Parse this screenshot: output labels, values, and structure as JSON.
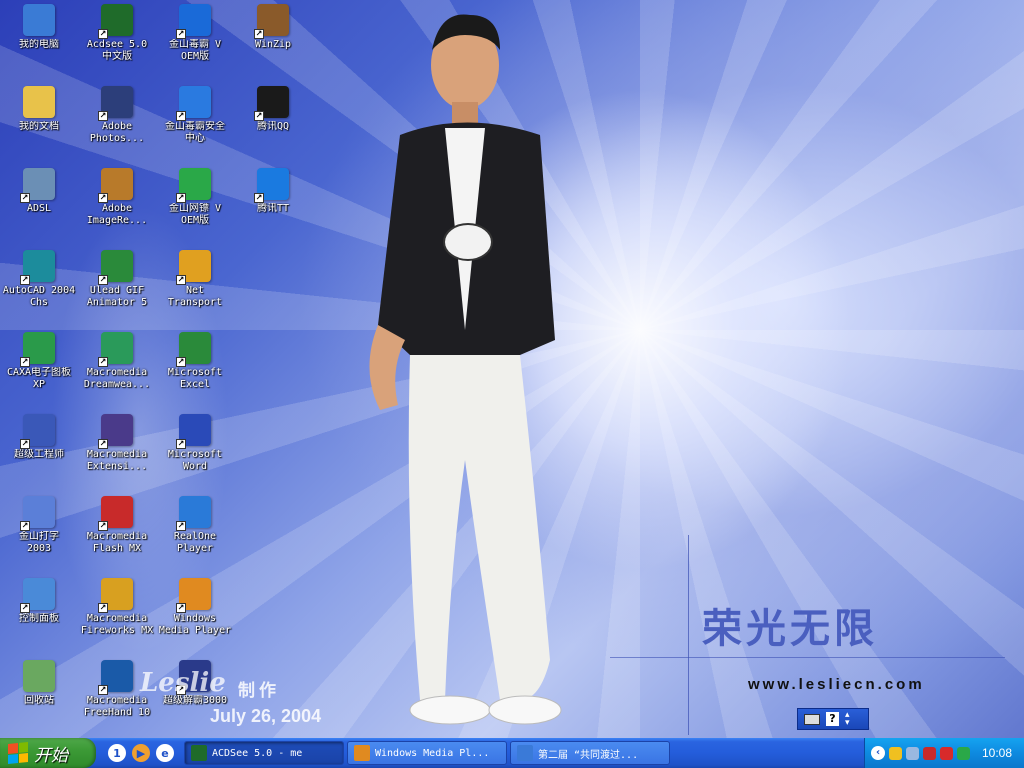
{
  "desktop": {
    "icons": [
      {
        "label": "我的电脑",
        "icon": "my-computer-icon",
        "color": "#3a7bd5"
      },
      {
        "label": "我的文档",
        "icon": "my-documents-icon",
        "color": "#e8c24a"
      },
      {
        "label": "ADSL",
        "icon": "network-icon",
        "color": "#6b8fb5"
      },
      {
        "label": "AutoCAD 2004\nChs",
        "icon": "autocad-icon",
        "color": "#1c8c9c"
      },
      {
        "label": "CAXA电子图板\nXP",
        "icon": "caxa-icon",
        "color": "#2a9a4a"
      },
      {
        "label": "超级工程师",
        "icon": "super-engineer-icon",
        "color": "#3a58b8"
      },
      {
        "label": "金山打字\n2003",
        "icon": "typing-icon",
        "color": "#5b7fd8"
      },
      {
        "label": "控制面板",
        "icon": "control-panel-icon",
        "color": "#4a8ad8"
      },
      {
        "label": "回收站",
        "icon": "recycle-bin-icon",
        "color": "#6aa860"
      },
      {
        "label": "Acdsee 5.0\n中文版",
        "icon": "acdsee-icon",
        "color": "#1f6b2a"
      },
      {
        "label": "Adobe\nPhotos...",
        "icon": "photoshop-icon",
        "color": "#2c3e7a"
      },
      {
        "label": "Adobe\nImageRe...",
        "icon": "imageready-icon",
        "color": "#b87a2a"
      },
      {
        "label": "Ulead GIF\nAnimator 5",
        "icon": "gif-animator-icon",
        "color": "#2a8a3a"
      },
      {
        "label": "Macromedia\nDreamwea...",
        "icon": "dreamweaver-icon",
        "color": "#2a9a5a"
      },
      {
        "label": "Macromedia\nExtensi...",
        "icon": "extension-icon",
        "color": "#4a3a8a"
      },
      {
        "label": "Macromedia\nFlash MX",
        "icon": "flash-icon",
        "color": "#c82a2a"
      },
      {
        "label": "Macromedia\nFireworks MX",
        "icon": "fireworks-icon",
        "color": "#d8a020"
      },
      {
        "label": "Macromedia\nFreeHand 10",
        "icon": "freehand-icon",
        "color": "#1a5aa8"
      },
      {
        "label": "金山毒霸 V\nOEM版",
        "icon": "antivirus-icon",
        "color": "#1a6ad8"
      },
      {
        "label": "金山毒霸安全\n中心",
        "icon": "security-center-icon",
        "color": "#2a7ae0"
      },
      {
        "label": "金山网镖 V\nOEM版",
        "icon": "firewall-icon",
        "color": "#2aa848"
      },
      {
        "label": "Net\nTransport",
        "icon": "net-transport-icon",
        "color": "#e0a020"
      },
      {
        "label": "Microsoft\nExcel",
        "icon": "excel-icon",
        "color": "#2a8a3a"
      },
      {
        "label": "Microsoft\nWord",
        "icon": "word-icon",
        "color": "#2a4ab8"
      },
      {
        "label": "RealOne\nPlayer",
        "icon": "realone-icon",
        "color": "#2a7ad8"
      },
      {
        "label": "Windows\nMedia Player",
        "icon": "media-player-icon",
        "color": "#e08a20"
      },
      {
        "label": "超级解霸3000",
        "icon": "super-jieba-icon",
        "color": "#2a3a8a"
      },
      {
        "label": "WinZip",
        "icon": "winzip-icon",
        "color": "#8a5a2a"
      },
      {
        "label": "腾讯QQ",
        "icon": "qq-icon",
        "color": "#1a1a1a"
      },
      {
        "label": "腾讯TT",
        "icon": "tt-icon",
        "color": "#1a7ae0"
      }
    ]
  },
  "wallpaper": {
    "title": "荣光无限",
    "site": "www.lesliecn.com",
    "signature": "Leslie",
    "made": "制作",
    "date": "July 26, 2004"
  },
  "langbar": {
    "help": "?"
  },
  "taskbar": {
    "start_label": "开始",
    "quick_launch": [
      {
        "icon": "show-desktop-icon",
        "color": "#ffffff",
        "glyph": "1"
      },
      {
        "icon": "media-player-quick-icon",
        "color": "#f0a030",
        "glyph": "▶"
      },
      {
        "icon": "ie-icon",
        "color": "#ffffff",
        "glyph": "e"
      }
    ],
    "tasks": [
      {
        "label": "ACDSee 5.0 - me",
        "icon": "acdsee-task-icon",
        "color": "#1f6b2a",
        "active": true
      },
      {
        "label": "Windows Media Pl...",
        "icon": "media-player-task-icon",
        "color": "#e08a20",
        "active": false
      },
      {
        "label": "第二届 “共同渡过...",
        "icon": "ie-task-icon",
        "color": "#3a7ad8",
        "active": false
      }
    ],
    "tray": [
      {
        "icon": "qq-tray-icon",
        "color": "#f0c020"
      },
      {
        "icon": "network-tray-icon",
        "color": "#9ab8e0"
      },
      {
        "icon": "firewall-tray-icon",
        "color": "#c82a2a"
      },
      {
        "icon": "antivirus-tray-icon",
        "color": "#d82a2a"
      },
      {
        "icon": "tt-tray-icon",
        "color": "#2aa848"
      }
    ],
    "chevron": "‹",
    "clock": "10:08"
  }
}
